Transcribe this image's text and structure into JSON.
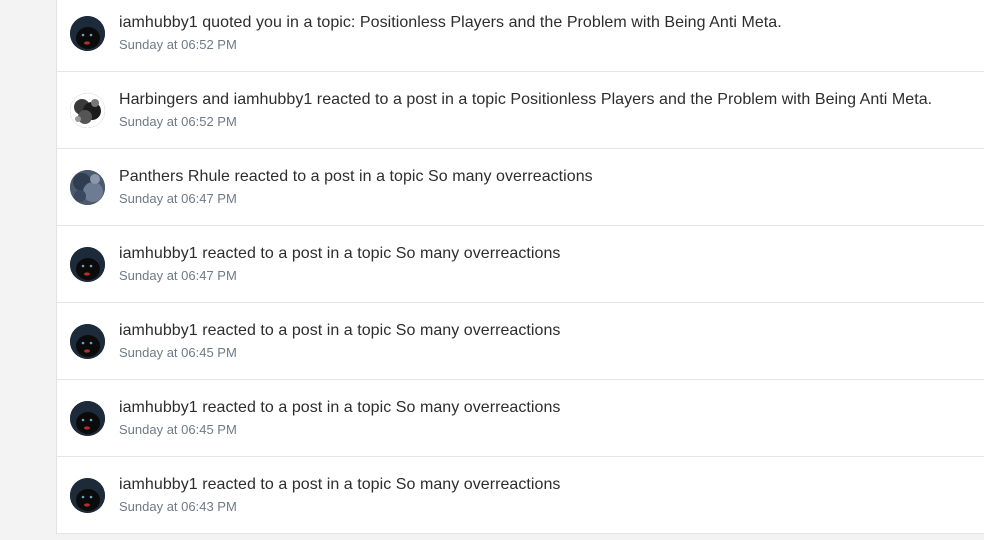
{
  "notifications": [
    {
      "text": "iamhubby1 quoted you in a topic: Positionless Players and the Problem with Being Anti Meta.",
      "time": "Sunday at 06:52 PM",
      "avatar": "panther"
    },
    {
      "text": "Harbingers and iamhubby1 reacted to a post in a topic Positionless Players and the Problem with Being Anti Meta.",
      "time": "Sunday at 06:52 PM",
      "avatar": "grayscale"
    },
    {
      "text": "Panthers Rhule reacted to a post in a topic So many overreactions",
      "time": "Sunday at 06:47 PM",
      "avatar": "blue-photo"
    },
    {
      "text": "iamhubby1 reacted to a post in a topic So many overreactions",
      "time": "Sunday at 06:47 PM",
      "avatar": "panther"
    },
    {
      "text": "iamhubby1 reacted to a post in a topic So many overreactions",
      "time": "Sunday at 06:45 PM",
      "avatar": "panther"
    },
    {
      "text": "iamhubby1 reacted to a post in a topic So many overreactions",
      "time": "Sunday at 06:45 PM",
      "avatar": "panther"
    },
    {
      "text": "iamhubby1 reacted to a post in a topic So many overreactions",
      "time": "Sunday at 06:43 PM",
      "avatar": "panther"
    }
  ]
}
